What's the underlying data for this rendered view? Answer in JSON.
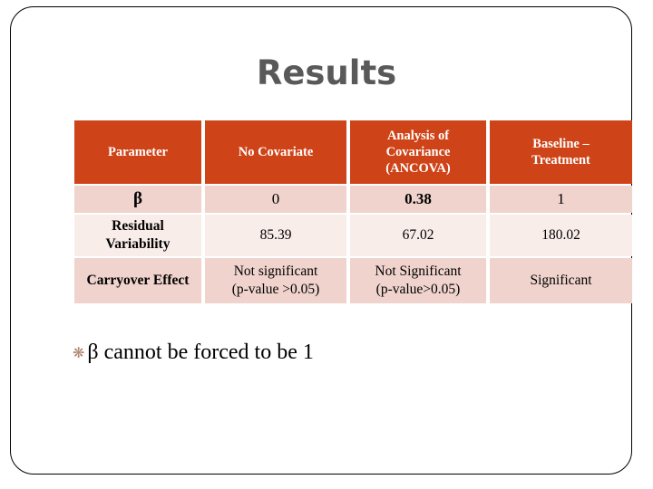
{
  "slide": {
    "title": "Results",
    "title_color": "#595959",
    "background_color": "#ffffff",
    "border_color": "#000000"
  },
  "table": {
    "header_background": "#ce4418",
    "header_text_color": "#ffffff",
    "row_dark_background": "#efd3cc",
    "row_light_background": "#f9edea",
    "highlight_color": "#1f1f9f",
    "columns": [
      {
        "label": "Parameter"
      },
      {
        "label": "No Covariate"
      },
      {
        "label_line1": "Analysis of",
        "label_line2": "Covariance",
        "label_line3": "(ANCOVA)"
      },
      {
        "label_line1": "Baseline –",
        "label_line2": "Treatment"
      }
    ],
    "rows": [
      {
        "parameter": "β",
        "no_covariate": "0",
        "ancova": "0.38",
        "baseline_treatment": "1"
      },
      {
        "parameter_line1": "Residual",
        "parameter_line2": "Variability",
        "no_covariate": "85.39",
        "ancova": "67.02",
        "baseline_treatment": "180.02"
      },
      {
        "parameter": "Carryover Effect",
        "no_covariate_line1": "Not significant",
        "no_covariate_line2": "(p-value >0.05)",
        "ancova_line1": "Not Significant",
        "ancova_line2": "(p-value>0.05)",
        "baseline_treatment": "Significant"
      }
    ]
  },
  "bullet": {
    "glyph": "❋",
    "glyph_name": "florette-bullet-icon",
    "text": "β cannot be forced to be 1"
  }
}
